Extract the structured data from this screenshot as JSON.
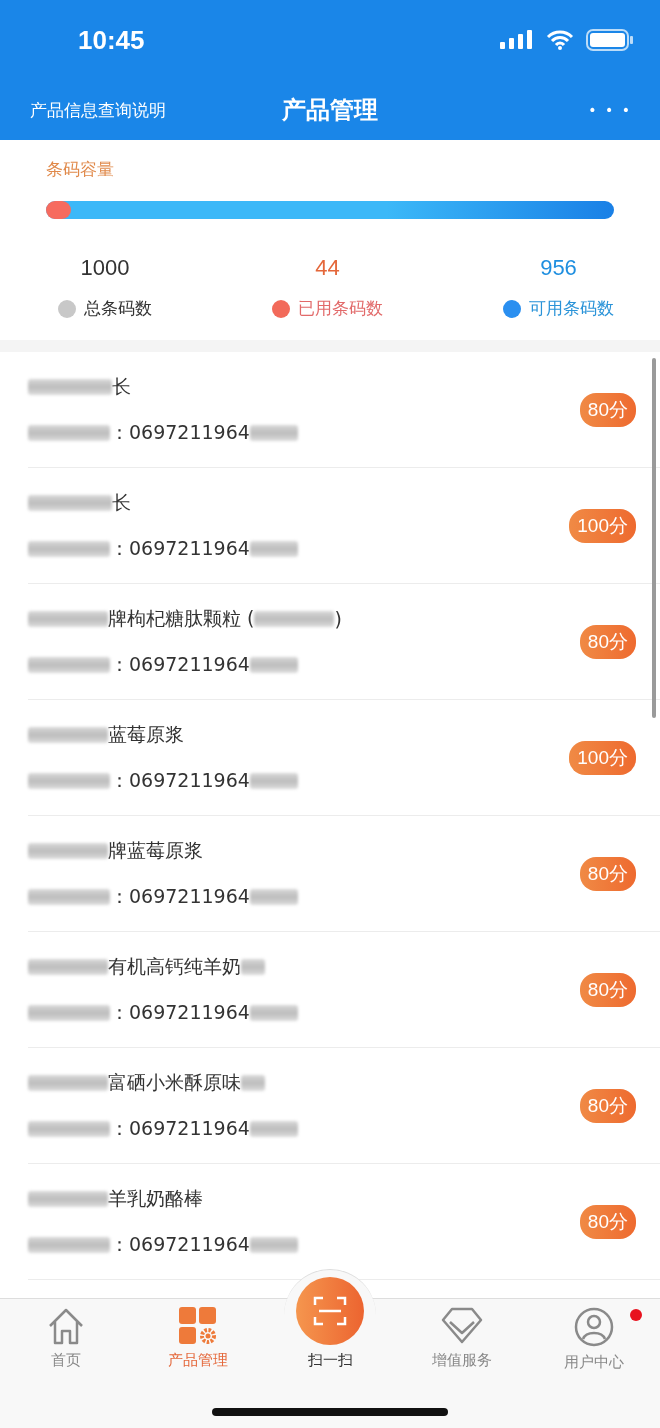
{
  "status_bar": {
    "time": "10:45"
  },
  "nav": {
    "left_link": "产品信息查询说明",
    "title": "产品管理",
    "more": "• • •"
  },
  "capacity": {
    "title": "条码容量",
    "level": 0.044,
    "stats": [
      {
        "value": "1000",
        "label": "总条码数",
        "color": "#c8c8c8"
      },
      {
        "value": "44",
        "label": "已用条码数",
        "color": "#f26a5a"
      },
      {
        "value": "956",
        "label": "可用条码数",
        "color": "#2a8ff0"
      }
    ]
  },
  "products": [
    {
      "name": "长",
      "tail_blur": false,
      "code": "：0697211964",
      "score": "80分"
    },
    {
      "name": "长",
      "tail_blur": false,
      "code": "：0697211964",
      "score": "100分"
    },
    {
      "name": "牌枸杞糖肽颗粒 (",
      "tail_blur": true,
      "name_end": ")",
      "code": "：0697211964",
      "score": "80分"
    },
    {
      "name": "蓝莓原浆",
      "tail_blur": false,
      "code": "：0697211964",
      "score": "100分"
    },
    {
      "name": "牌蓝莓原浆",
      "tail_blur": false,
      "code": "：0697211964",
      "score": "80分"
    },
    {
      "name": "有机高钙纯羊奶",
      "tail_blur": true,
      "code": "：0697211964",
      "score": "80分"
    },
    {
      "name": "富硒小米酥原味",
      "tail_blur": true,
      "code": "：0697211964",
      "score": "80分"
    },
    {
      "name": "羊乳奶酪棒",
      "tail_blur": false,
      "code": "：0697211964",
      "score": "80分"
    }
  ],
  "tab_bar": [
    {
      "kind": "home",
      "label": "首页",
      "selected": false
    },
    {
      "kind": "products",
      "label": "产品管理",
      "selected": true
    },
    {
      "kind": "scan",
      "label": "扫一扫",
      "selected": false
    },
    {
      "kind": "services",
      "label": "增值服务",
      "selected": false
    },
    {
      "kind": "user",
      "label": "用户中心",
      "selected": false,
      "badge": true
    }
  ]
}
